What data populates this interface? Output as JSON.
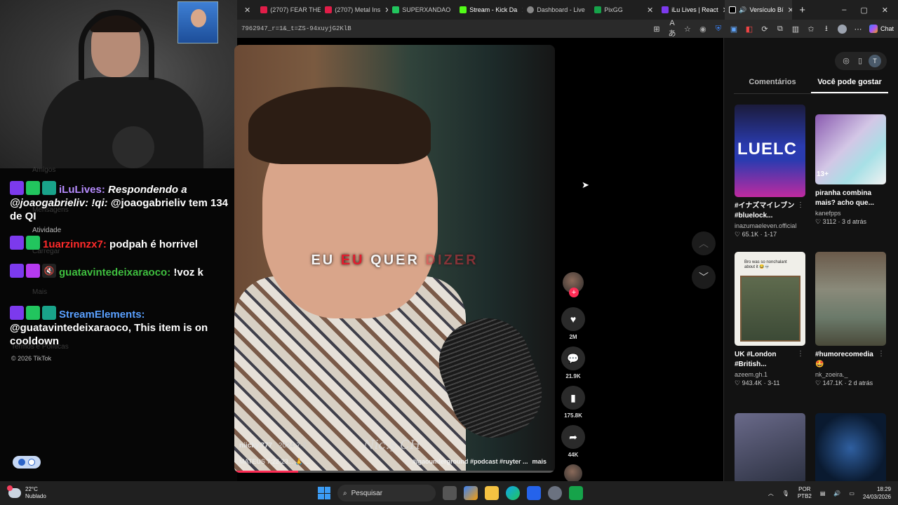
{
  "browser": {
    "tabs": [
      {
        "label": "(2707) FEAR THE",
        "color": "#e11d48"
      },
      {
        "label": "(2707) Metal Ins",
        "color": "#e11d48"
      },
      {
        "label": "SUPERXANDAO",
        "color": "#22c55e"
      },
      {
        "label": "Stream - Kick Da",
        "color": "#53fc18"
      },
      {
        "label": "Dashboard - Live",
        "color": "#888888"
      },
      {
        "label": "PixGG",
        "color": "#16a34a"
      },
      {
        "label": "iLu Lives | React",
        "color": "#7c3aed"
      },
      {
        "label": "Versículo Bí",
        "color": "#ffffff"
      }
    ],
    "new_tab": "+",
    "window_min": "–",
    "window_max": "▢",
    "window_close": "✕",
    "url": "7962947_r=1&_t=ZS-94xuyjG2KlB",
    "chat_label": "Chat"
  },
  "chat": {
    "ghost_items": [
      "Amigos",
      "Mensagens",
      "Atividade",
      "Carregar",
      "Mais",
      "Termos e Políticas"
    ],
    "messages": [
      {
        "user": "iLuLives:",
        "color": "#b78cff",
        "text": "Respondendo a @joaogabrieliv: !qi:",
        "text2": "@joaogabrieliv tem 134 de QI",
        "badges": [
          "twitch",
          "edit",
          "bot"
        ]
      },
      {
        "user": "1uarzinnzx7:",
        "color": "#ff2a2a",
        "text": "podpah é horrivel",
        "badges": [
          "twitch",
          "edit"
        ]
      },
      {
        "user": "guatavintedeixaraoco:",
        "color": "#3fbf3f",
        "text": "!voz k",
        "badges": [
          "twitch",
          "heart",
          "mute"
        ]
      },
      {
        "user": "StreamElements:",
        "color": "#5aa0ff",
        "text": "@guatavintedeixaraoco, This item is on cooldown",
        "badges": [
          "twitch",
          "edit",
          "bot"
        ]
      }
    ],
    "copyright": "© 2026 TikTok"
  },
  "video": {
    "caption_words": [
      "EU",
      "EU",
      "QUER",
      "DIZER"
    ],
    "author": "niicky.777",
    "date": "2024-7-2",
    "title": "MATEUS 7:22-23... 🙏 ...",
    "tags": "#igaounderground #podcast #ruyter ...",
    "more": "mais",
    "watermark": "Nic.ş CH",
    "progress": 0.2
  },
  "actions": {
    "likes": "2M",
    "comments": "21.9K",
    "saves": "175.8K",
    "shares": "44K"
  },
  "right_panel": {
    "tabs": [
      "Comentários",
      "Você pode gostar"
    ],
    "user_initial": "T",
    "cards": [
      {
        "title": "#イナズマイレブン #bluelock...",
        "author": "inazumaeleven.official",
        "likes": "65.1K",
        "time": "1-17"
      },
      {
        "title": "piranha combina mais? acho que...",
        "author": "kanefpps",
        "likes": "3112",
        "time": "3 d atrás"
      },
      {
        "title": "UK #London #British...",
        "author": "azeem.gh.1",
        "likes": "943.4K",
        "time": "3-11"
      },
      {
        "title": "#humorecomedia 🤩",
        "author": "nk_zoeira._",
        "likes": "147.1K",
        "time": "2 d atrás"
      }
    ],
    "thumb_texts": {
      "card2_overlay": "13+",
      "card3_caption": "Bro was so nonchalant about it 😂💀",
      "card1_big": "LUELC"
    }
  },
  "taskbar": {
    "temp": "22°C",
    "weather": "Nublado",
    "search": "Pesquisar",
    "lang1": "POR",
    "lang2": "PTB2",
    "time": "18:29",
    "date": "24/03/2026"
  }
}
